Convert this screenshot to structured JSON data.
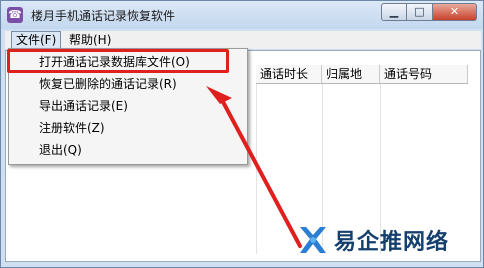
{
  "window": {
    "title": "楼月手机通话记录恢复软件"
  },
  "menubar": {
    "file": "文件(F)",
    "help": "帮助(H)"
  },
  "columns": [
    "通话时长",
    "归属地",
    "通话号码"
  ],
  "file_menu": {
    "items": [
      "打开通话记录数据库文件(O)",
      "恢复已删除的通话记录(R)",
      "导出通话记录(E)",
      "注册软件(Z)",
      "退出(Q)"
    ]
  },
  "watermark": {
    "text": "易企推网络"
  },
  "colors": {
    "highlight": "#e01f1f",
    "arrow": "#e01f1f",
    "watermark": "#15406e"
  }
}
